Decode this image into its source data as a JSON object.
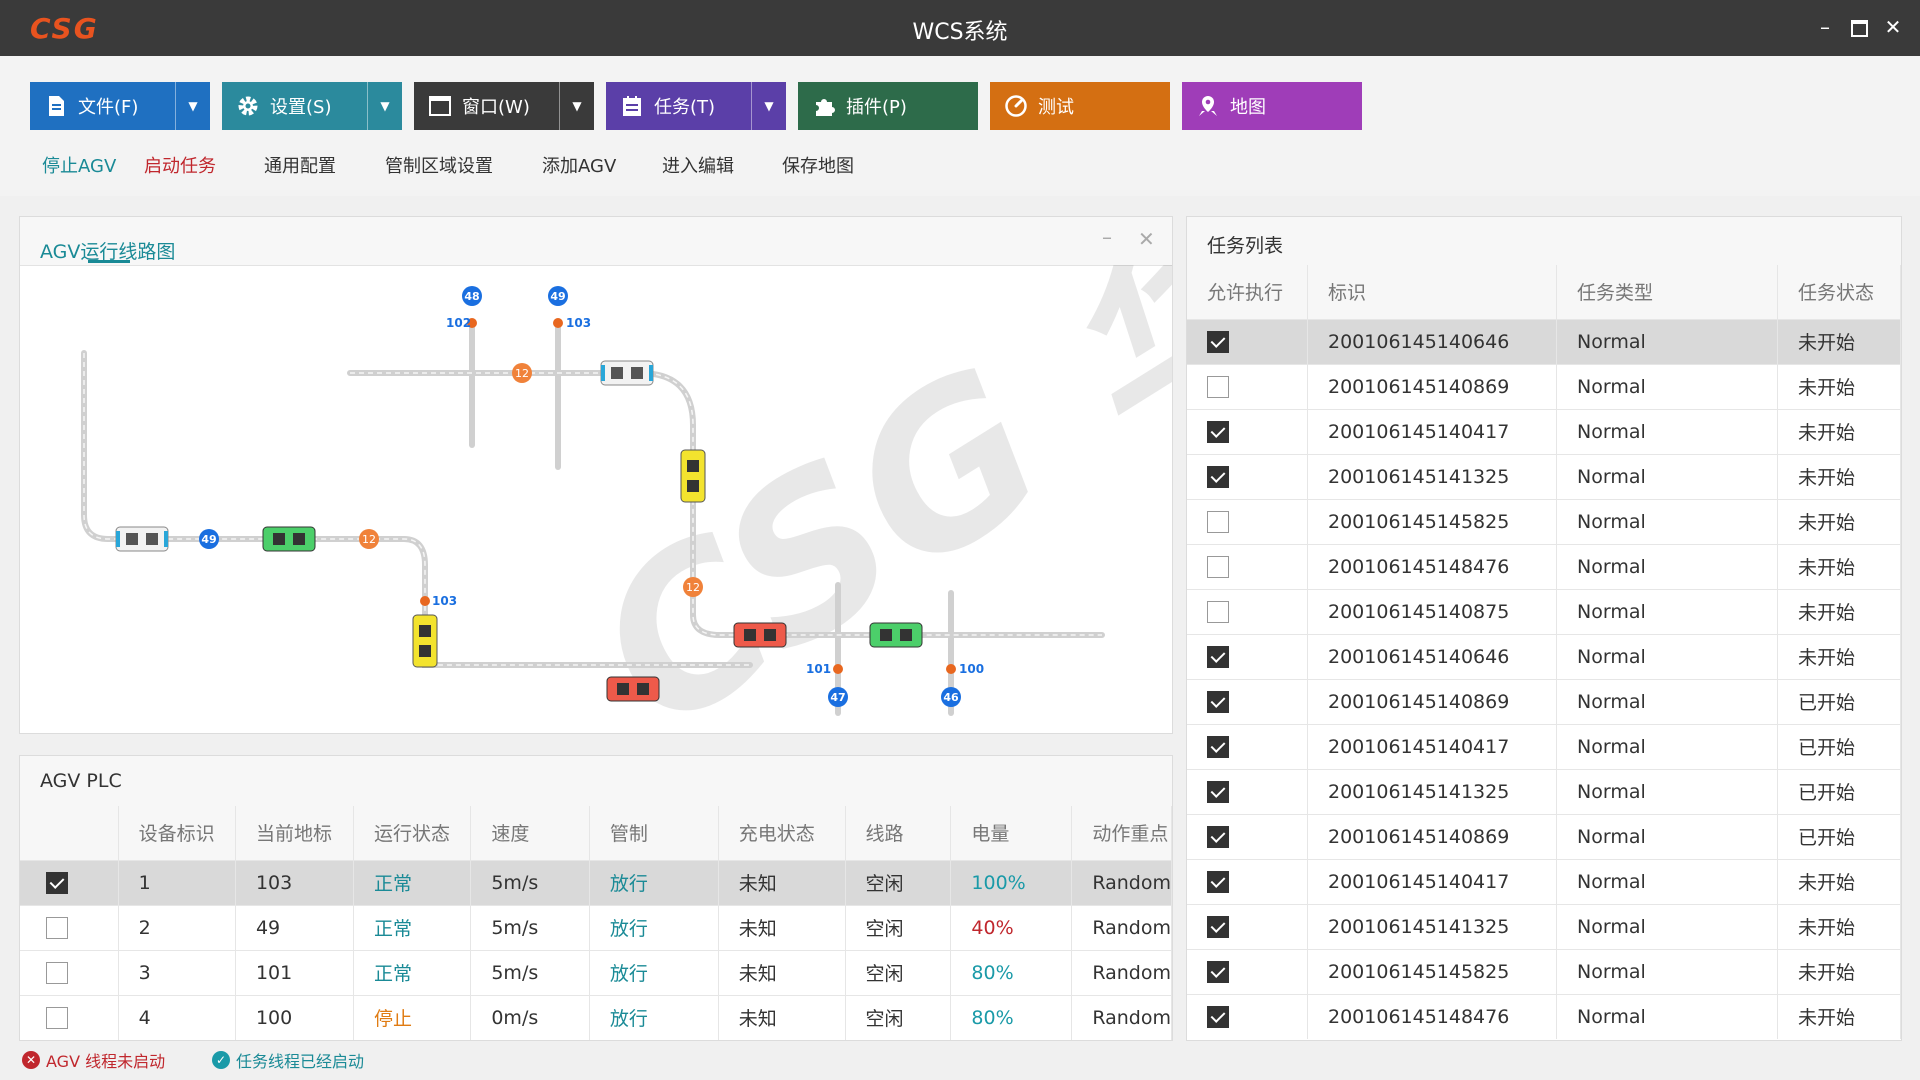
{
  "window": {
    "logo": "CSG",
    "title": "WCS系统"
  },
  "toolbar": {
    "buttons": [
      {
        "label": "文件(F)",
        "icon": "document-icon",
        "color": "#1f70c1"
      },
      {
        "label": "设置(S)",
        "icon": "gear-icon",
        "color": "#2b8a9d"
      },
      {
        "label": "窗口(W)",
        "icon": "window-icon",
        "color": "#3a3a3a"
      },
      {
        "label": "任务(T)",
        "icon": "task-list-icon",
        "color": "#5b3fa8"
      },
      {
        "label": "插件(P)",
        "icon": "puzzle-icon",
        "color": "#2d6b4a"
      },
      {
        "label": "测试",
        "icon": "gauge-icon",
        "color": "#d46f12"
      },
      {
        "label": "地图",
        "icon": "map-pin-icon",
        "color": "#9f3db8"
      }
    ],
    "links": [
      {
        "label": "停止AGV",
        "color": "#1a8a96"
      },
      {
        "label": "启动任务",
        "color": "#c0272d"
      },
      {
        "label": "通用配置",
        "color": "#333333"
      },
      {
        "label": "管制区域设置",
        "color": "#333333"
      },
      {
        "label": "添加AGV",
        "color": "#333333"
      },
      {
        "label": "进入编辑",
        "color": "#333333"
      },
      {
        "label": "保存地图",
        "color": "#333333"
      }
    ]
  },
  "route_panel": {
    "title": "AGV运行线路图",
    "watermark": "CSG 华晓",
    "node_labels": [
      "48",
      "49",
      "102",
      "103",
      "12",
      "49",
      "12",
      "103",
      "12",
      "101",
      "100",
      "47",
      "46"
    ]
  },
  "task_panel": {
    "title": "任务列表",
    "columns": [
      "允许执行",
      "标识",
      "任务类型",
      "任务状态"
    ],
    "rows": [
      {
        "checked": true,
        "id": "200106145140646",
        "type": "Normal",
        "status": "未开始"
      },
      {
        "checked": false,
        "id": "200106145140869",
        "type": "Normal",
        "status": "未开始"
      },
      {
        "checked": true,
        "id": "200106145140417",
        "type": "Normal",
        "status": "未开始"
      },
      {
        "checked": true,
        "id": "200106145141325",
        "type": "Normal",
        "status": "未开始"
      },
      {
        "checked": false,
        "id": "200106145145825",
        "type": "Normal",
        "status": "未开始"
      },
      {
        "checked": false,
        "id": "200106145148476",
        "type": "Normal",
        "status": "未开始"
      },
      {
        "checked": false,
        "id": "200106145140875",
        "type": "Normal",
        "status": "未开始"
      },
      {
        "checked": true,
        "id": "200106145140646",
        "type": "Normal",
        "status": "未开始"
      },
      {
        "checked": true,
        "id": "200106145140869",
        "type": "Normal",
        "status": "已开始"
      },
      {
        "checked": true,
        "id": "200106145140417",
        "type": "Normal",
        "status": "已开始"
      },
      {
        "checked": true,
        "id": "200106145141325",
        "type": "Normal",
        "status": "已开始"
      },
      {
        "checked": true,
        "id": "200106145140869",
        "type": "Normal",
        "status": "已开始"
      },
      {
        "checked": true,
        "id": "200106145140417",
        "type": "Normal",
        "status": "未开始"
      },
      {
        "checked": true,
        "id": "200106145141325",
        "type": "Normal",
        "status": "未开始"
      },
      {
        "checked": true,
        "id": "200106145145825",
        "type": "Normal",
        "status": "未开始"
      },
      {
        "checked": true,
        "id": "200106145148476",
        "type": "Normal",
        "status": "未开始"
      }
    ]
  },
  "plc_panel": {
    "title": "AGV PLC",
    "columns": [
      "",
      "设备标识",
      "当前地标",
      "运行状态",
      "速度",
      "管制",
      "充电状态",
      "线路",
      "电量",
      "动作重点"
    ],
    "rows": [
      {
        "checked": true,
        "device": "1",
        "landmark": "103",
        "run_state": "正常",
        "run_color": "#1a8a96",
        "speed": "5m/s",
        "control": "放行",
        "charge": "未知",
        "line": "空闲",
        "battery": "100%",
        "battery_color": "#1a9aa8",
        "action": "Random"
      },
      {
        "checked": false,
        "device": "2",
        "landmark": "49",
        "run_state": "正常",
        "run_color": "#1a8a96",
        "speed": "5m/s",
        "control": "放行",
        "charge": "未知",
        "line": "空闲",
        "battery": "40%",
        "battery_color": "#c0272d",
        "action": "Random"
      },
      {
        "checked": false,
        "device": "3",
        "landmark": "101",
        "run_state": "正常",
        "run_color": "#1a8a96",
        "speed": "5m/s",
        "control": "放行",
        "charge": "未知",
        "line": "空闲",
        "battery": "80%",
        "battery_color": "#1a9aa8",
        "action": "Random"
      },
      {
        "checked": false,
        "device": "4",
        "landmark": "100",
        "run_state": "停止",
        "run_color": "#e07b12",
        "speed": "0m/s",
        "control": "放行",
        "charge": "未知",
        "line": "空闲",
        "battery": "80%",
        "battery_color": "#1a9aa8",
        "action": "Random"
      }
    ]
  },
  "status_bar": {
    "agv_thread": "AGV 线程未启动",
    "task_thread": "任务线程已经启动"
  }
}
